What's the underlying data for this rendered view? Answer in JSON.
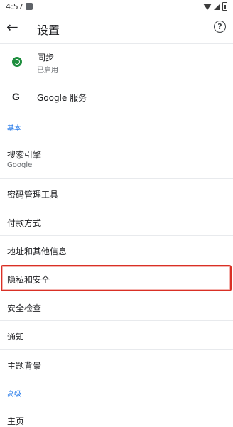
{
  "statusbar": {
    "time": "4:57"
  },
  "appbar": {
    "title": "设置"
  },
  "items": {
    "sync": {
      "label": "同步",
      "sub": "已启用"
    },
    "google_services": {
      "label": "Google 服务"
    },
    "section_basic": "基本",
    "search_engine": {
      "label": "搜索引擎",
      "sub": "Google"
    },
    "passwords": {
      "label": "密码管理工具"
    },
    "payment": {
      "label": "付款方式"
    },
    "addresses": {
      "label": "地址和其他信息"
    },
    "privacy": {
      "label": "隐私和安全"
    },
    "safety_check": {
      "label": "安全检查"
    },
    "notifications": {
      "label": "通知"
    },
    "theme": {
      "label": "主题背景"
    },
    "section_advanced": "高级",
    "homepage": {
      "label": "主页"
    }
  },
  "icons": {
    "back": "arrow-back-icon",
    "help": "help-icon",
    "sync": "sync-icon",
    "google": "google-icon"
  },
  "colors": {
    "accent": "#1a73e8",
    "sync_green": "#1e8e3e",
    "highlight_red": "#d93025"
  }
}
